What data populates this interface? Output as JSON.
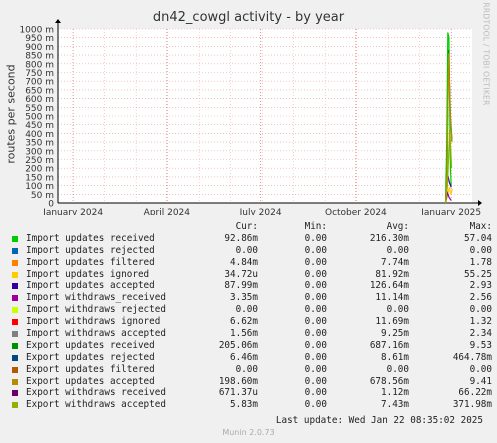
{
  "title": "dn42_cowgl activity - by year",
  "side_label": "RRDTOOL / TOBI OETIKER",
  "legend_headers": [
    "Cur:",
    "Min:",
    "Avg:",
    "Max:"
  ],
  "legend": [
    {
      "name": "Import updates received",
      "cur": "92.86m",
      "min": "0.00",
      "avg": "216.30m",
      "max": "57.04",
      "color": "#00cc00"
    },
    {
      "name": "Import updates rejected",
      "cur": "0.00",
      "min": "0.00",
      "avg": "0.00",
      "max": "0.00",
      "color": "#0066b3"
    },
    {
      "name": "Import updates filtered",
      "cur": "4.84m",
      "min": "0.00",
      "avg": "7.74m",
      "max": "1.78",
      "color": "#ff8000"
    },
    {
      "name": "Import updates ignored",
      "cur": "34.72u",
      "min": "0.00",
      "avg": "81.92m",
      "max": "55.25",
      "color": "#ffcc00"
    },
    {
      "name": "Import updates accepted",
      "cur": "87.99m",
      "min": "0.00",
      "avg": "126.64m",
      "max": "2.93",
      "color": "#330099"
    },
    {
      "name": "Import withdraws_received",
      "cur": "3.35m",
      "min": "0.00",
      "avg": "11.14m",
      "max": "2.56",
      "color": "#990099"
    },
    {
      "name": "Import withdraws rejected",
      "cur": "0.00",
      "min": "0.00",
      "avg": "0.00",
      "max": "0.00",
      "color": "#ccff00"
    },
    {
      "name": "Import withdraws ignored",
      "cur": "6.62m",
      "min": "0.00",
      "avg": "11.69m",
      "max": "1.32",
      "color": "#ff0000"
    },
    {
      "name": "Import withdraws accepted",
      "cur": "1.56m",
      "min": "0.00",
      "avg": "9.25m",
      "max": "2.34",
      "color": "#808080"
    },
    {
      "name": "Export updates received",
      "cur": "205.06m",
      "min": "0.00",
      "avg": "687.16m",
      "max": "9.53",
      "color": "#008f00"
    },
    {
      "name": "Export updates rejected",
      "cur": "6.46m",
      "min": "0.00",
      "avg": "8.61m",
      "max": "464.78m",
      "color": "#00487d"
    },
    {
      "name": "Export updates filtered",
      "cur": "0.00",
      "min": "0.00",
      "avg": "0.00",
      "max": "0.00",
      "color": "#b35a00"
    },
    {
      "name": "Export updates accepted",
      "cur": "198.60m",
      "min": "0.00",
      "avg": "678.56m",
      "max": "9.41",
      "color": "#b38f00"
    },
    {
      "name": "Export withdraws received",
      "cur": "671.37u",
      "min": "0.00",
      "avg": "1.12m",
      "max": "66.22m",
      "color": "#6b006b"
    },
    {
      "name": "Export withdraws accepted",
      "cur": "5.83m",
      "min": "0.00",
      "avg": "7.43m",
      "max": "371.98m",
      "color": "#8fb300"
    }
  ],
  "last_update": "Last update:  Wed Jan 22 08:35:02 2025",
  "footer": "Munin 2.0.73",
  "chart_data": {
    "type": "line",
    "title": "dn42_cowgl activity - by year",
    "ylabel": "routes per second",
    "yticks": [
      "0",
      "50 m",
      "100 m",
      "150 m",
      "200 m",
      "250 m",
      "300 m",
      "350 m",
      "400 m",
      "450 m",
      "500 m",
      "550 m",
      "600 m",
      "650 m",
      "700 m",
      "750 m",
      "800 m",
      "850 m",
      "900 m",
      "950 m",
      "1000 m"
    ],
    "ylim": [
      0,
      1000
    ],
    "xticks": [
      {
        "label": "January 2024",
        "t": 0.0
      },
      {
        "label": "April 2024",
        "t": 0.2479
      },
      {
        "label": "July 2024",
        "t": 0.4959
      },
      {
        "label": "October 2024",
        "t": 0.7479
      },
      {
        "label": "January 2025",
        "t": 1.0
      }
    ],
    "xlim_t": [
      -0.04,
      1.055
    ],
    "series": [
      {
        "name": "Import updates received",
        "color": "#00cc00",
        "points": [
          [
            0.985,
            0
          ],
          [
            0.988,
            340
          ],
          [
            0.991,
            980
          ],
          [
            0.994,
            950
          ],
          [
            0.998,
            200
          ],
          [
            1.0,
            100
          ]
        ]
      },
      {
        "name": "Import updates ignored",
        "color": "#ffcc00",
        "points": [
          [
            0.985,
            0
          ],
          [
            0.99,
            40
          ],
          [
            0.995,
            90
          ],
          [
            0.999,
            50
          ],
          [
            1.003,
            80
          ]
        ]
      },
      {
        "name": "Import updates accepted",
        "color": "#330099",
        "points": [
          [
            0.985,
            0
          ],
          [
            0.988,
            110
          ],
          [
            0.991,
            160
          ],
          [
            0.995,
            120
          ],
          [
            1.0,
            90
          ]
        ]
      },
      {
        "name": "Import withdraws_received",
        "color": "#990099",
        "points": [
          [
            0.985,
            0
          ],
          [
            0.99,
            60
          ],
          [
            0.995,
            30
          ],
          [
            1.0,
            15
          ]
        ]
      },
      {
        "name": "Export updates received",
        "color": "#008f00",
        "points": [
          [
            0.985,
            0
          ],
          [
            0.989,
            190
          ],
          [
            0.993,
            880
          ],
          [
            0.998,
            500
          ],
          [
            1.002,
            360
          ]
        ]
      },
      {
        "name": "Export updates accepted",
        "color": "#b38f00",
        "points": [
          [
            0.985,
            0
          ],
          [
            0.989,
            180
          ],
          [
            0.993,
            860
          ],
          [
            0.998,
            480
          ],
          [
            1.002,
            350
          ]
        ]
      },
      {
        "name": "Export withdraws accepted",
        "color": "#8fb300",
        "points": [
          [
            0.985,
            0
          ],
          [
            0.99,
            100
          ],
          [
            0.996,
            420
          ],
          [
            1.001,
            200
          ]
        ]
      }
    ]
  }
}
